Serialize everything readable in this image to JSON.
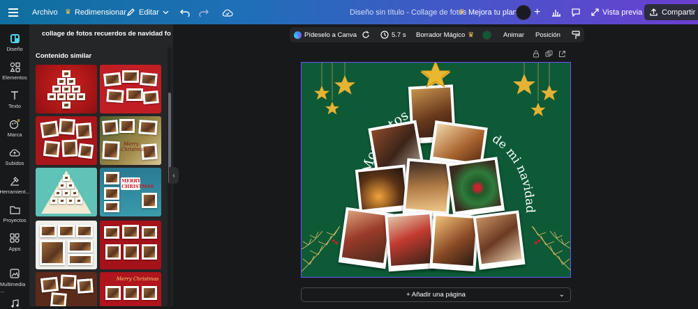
{
  "topbar": {
    "archivo": "Archivo",
    "redimensionar": "Redimensionar",
    "editar": "Editar",
    "doc_title": "Diseño sin título - Collage de fotos",
    "mejora": "Mejora tu plan",
    "vista_previa": "Vista previa",
    "compartir": "Compartir"
  },
  "rail": {
    "items": [
      {
        "label": "Diseño",
        "icon": "layout-icon"
      },
      {
        "label": "Elementos",
        "icon": "shapes-icon"
      },
      {
        "label": "Texto",
        "icon": "text-icon"
      },
      {
        "label": "Marca",
        "icon": "brand-icon"
      },
      {
        "label": "Subidos",
        "icon": "upload-icon"
      },
      {
        "label": "Herramient...",
        "icon": "tools-icon"
      },
      {
        "label": "Proyectos",
        "icon": "folder-icon"
      },
      {
        "label": "Apps",
        "icon": "apps-icon"
      },
      {
        "label": "Multimedia ...",
        "icon": "media-icon"
      }
    ]
  },
  "panel": {
    "title": "collage de fotos recuerdos de navidad fo...",
    "section": "Contenido similar",
    "thumb1_text": "Merry Christmas",
    "thumb2_text": "MERRY CHRISTMAS",
    "thumb3_text": "Merry Christmas"
  },
  "context_toolbar": {
    "pideselo": "Pídeselo a Canva",
    "duration": "5.7 s",
    "borrador": "Borrador Mágico",
    "animar": "Animar",
    "posicion": "Posición",
    "color": "#0e5a37"
  },
  "canvas": {
    "text_left": "Momentos",
    "text_right": "de mi navidad"
  },
  "add_page": "+ Añadir una página",
  "colors": {
    "background": "#18191b",
    "panel": "#252627",
    "page_green": "#0e5a37",
    "selection": "#6d52ff",
    "gold": "#e6b233"
  }
}
